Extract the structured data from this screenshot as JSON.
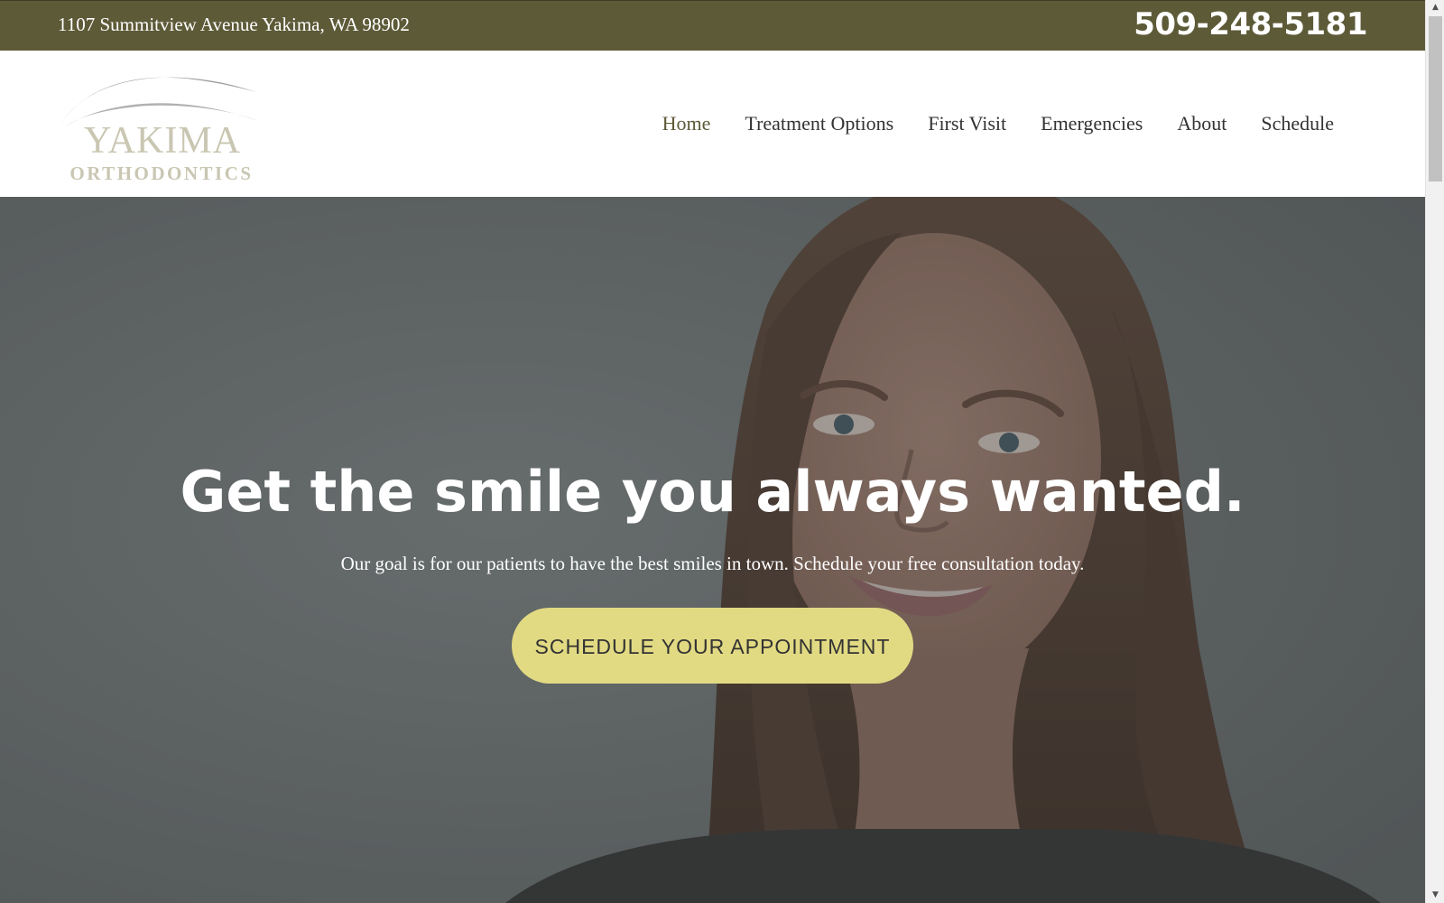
{
  "topbar": {
    "address": "1107 Summitview Avenue Yakima, WA 98902",
    "phone": "509-248-5181"
  },
  "logo": {
    "name": "YAKIMA",
    "subtitle": "ORTHODONTICS"
  },
  "nav": {
    "items": [
      {
        "label": "Home",
        "active": true
      },
      {
        "label": "Treatment Options",
        "active": false
      },
      {
        "label": "First Visit",
        "active": false
      },
      {
        "label": "Emergencies",
        "active": false
      },
      {
        "label": "About",
        "active": false
      },
      {
        "label": "Schedule",
        "active": false
      }
    ]
  },
  "hero": {
    "headline": "Get the smile you always wanted.",
    "subtext": "Our goal is for our patients to have the best smiles in town. Schedule your free consultation today.",
    "cta_label": "SCHEDULE YOUR APPOINTMENT"
  },
  "colors": {
    "topbar_bg": "#5d5a38",
    "cta_bg": "#e2da83",
    "nav_active": "#5d5a38",
    "logo_text": "#c9c6b2"
  },
  "icons": {
    "scroll_up": "scroll-up-arrow-icon",
    "scroll_down": "scroll-down-arrow-icon"
  }
}
